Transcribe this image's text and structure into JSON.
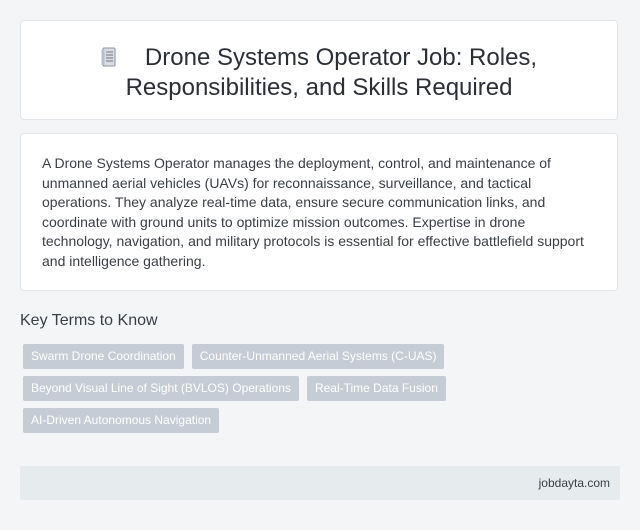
{
  "header": {
    "title_line1": "Drone Systems Operator Job: Roles,",
    "title_line2": "Responsibilities, and Skills Required",
    "icon": "document-icon"
  },
  "summary": {
    "text": "A Drone Systems Operator manages the deployment, control, and maintenance of unmanned aerial vehicles (UAVs) for reconnaissance, surveillance, and tactical operations. They analyze real-time data, ensure secure communication links, and coordinate with ground units to optimize mission outcomes. Expertise in drone technology, navigation, and military protocols is essential for effective battlefield support and intelligence gathering."
  },
  "key_terms": {
    "title": "Key Terms to Know",
    "tags": [
      "Swarm Drone Coordination",
      "Counter-Unmanned Aerial Systems (C-UAS)",
      "Beyond Visual Line of Sight (BVLOS) Operations",
      "Real-Time Data Fusion",
      "AI-Driven Autonomous Navigation"
    ]
  },
  "footer": {
    "source": "jobdayta.com"
  },
  "colors": {
    "background": "#f3f5f7",
    "tag_background": "#c5ccd6",
    "footer_background": "#e6ebee"
  }
}
